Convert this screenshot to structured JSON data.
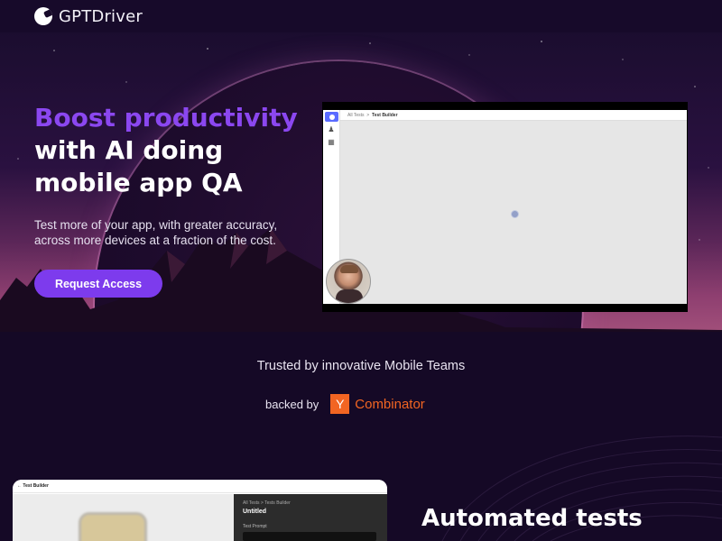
{
  "brand": {
    "name": "GPTDriver",
    "icon": "gptdriver-logo-icon"
  },
  "hero": {
    "headline_accent": "Boost productivity",
    "headline_line2": "with AI doing",
    "headline_line3": "mobile app QA",
    "subtext": "Test more of your app, with greater accuracy, across more devices at a fraction of the cost.",
    "cta_label": "Request Access",
    "accent_color": "#8b47f0",
    "cta_color": "#7d3bed"
  },
  "demo_video": {
    "breadcrumb_root": "All Tests",
    "breadcrumb_current": "Test Builder",
    "sidebar_icons": [
      "app-logo-icon",
      "user-icon",
      "document-icon"
    ]
  },
  "trust": {
    "headline": "Trusted by innovative Mobile Teams",
    "backed_label": "backed by",
    "yc_letter": "Y",
    "yc_name": "Combinator",
    "yc_color": "#f26522"
  },
  "builder_preview": {
    "top_label": "Test Builder",
    "breadcrumb": "All Tests  >  Tests Builder",
    "test_name": "Untitled",
    "prompt_label": "Test Prompt"
  },
  "features": {
    "title": "Automated tests"
  }
}
